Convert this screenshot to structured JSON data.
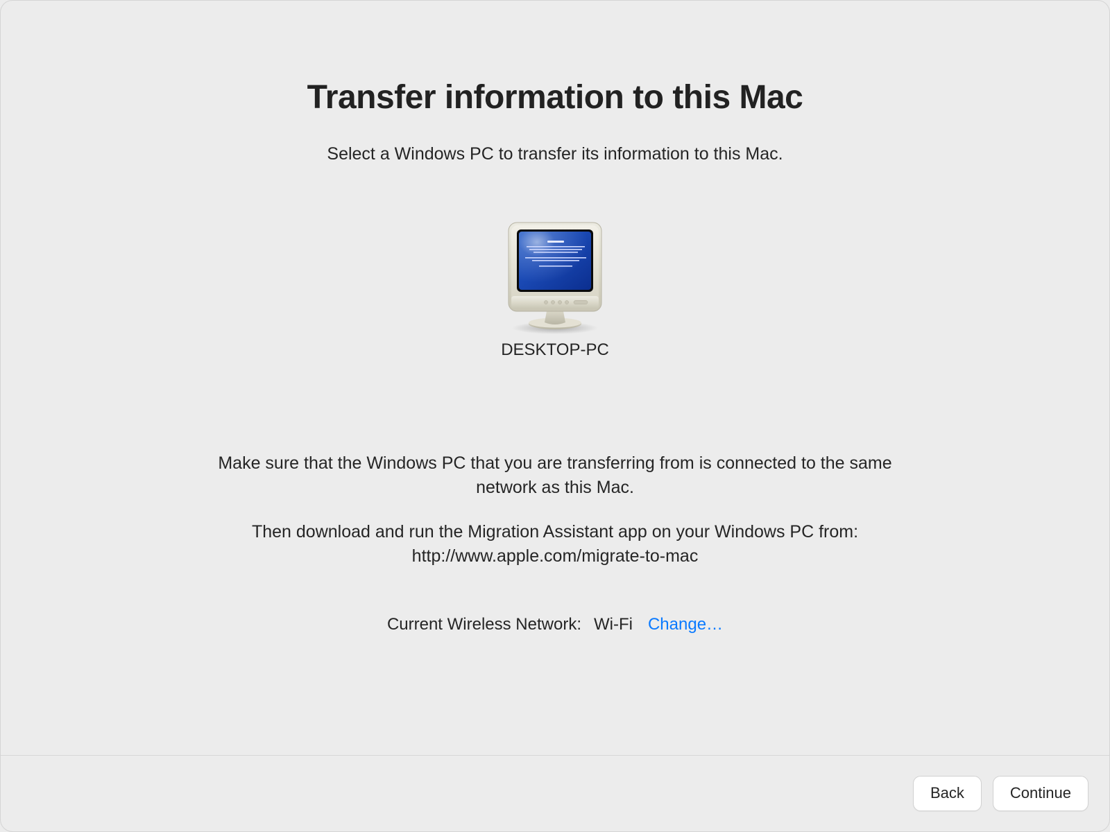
{
  "header": {
    "title": "Transfer information to this Mac",
    "subtitle": "Select a Windows PC to transfer its information to this Mac."
  },
  "device": {
    "name": "DESKTOP-PC"
  },
  "instructions": {
    "line1": "Make sure that the Windows PC that you are transferring from is connected to the same network as this Mac.",
    "line2": "Then download and run the Migration Assistant app on your Windows PC from: http://www.apple.com/migrate-to-mac"
  },
  "network": {
    "label": "Current Wireless Network:",
    "value": "Wi-Fi",
    "change_label": "Change…"
  },
  "buttons": {
    "back": "Back",
    "continue": "Continue"
  }
}
